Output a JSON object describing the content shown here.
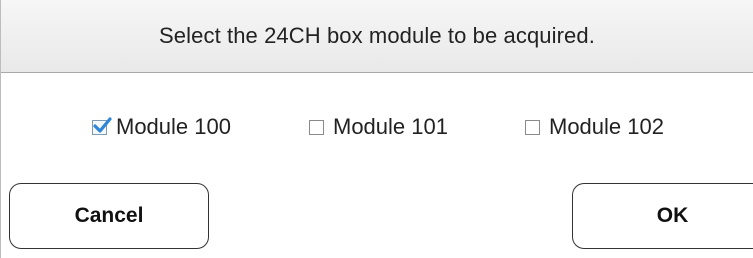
{
  "dialog": {
    "title": "Select the 24CH box module to be acquired.",
    "modules": [
      {
        "label": "Module 100",
        "checked": true
      },
      {
        "label": "Module 101",
        "checked": false
      },
      {
        "label": "Module 102",
        "checked": false
      }
    ],
    "cancel_label": "Cancel",
    "ok_label": "OK"
  },
  "colors": {
    "checkmark": "#2f86d6",
    "title_bar": "#eeeeee",
    "text": "#222222"
  }
}
